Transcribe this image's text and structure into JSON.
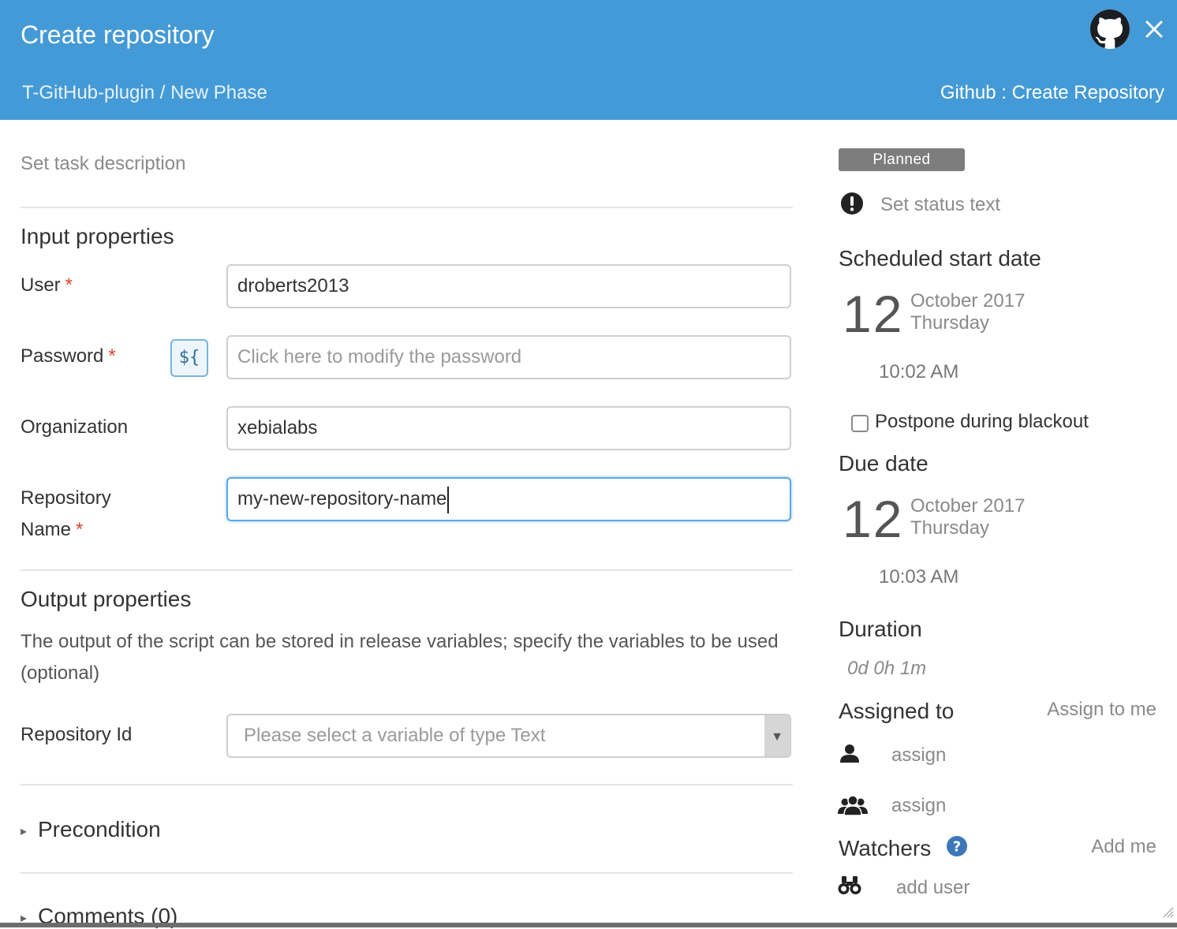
{
  "header": {
    "title": "Create repository",
    "breadcrumb": "T-GitHub-plugin / New Phase",
    "task_type": "Github : Create Repository",
    "icons": [
      "github-icon",
      "close-icon"
    ],
    "color": "#449ad6"
  },
  "main": {
    "task_description_placeholder": "Set task description",
    "input_properties": {
      "title": "Input properties",
      "required_marker": "*",
      "fields": [
        {
          "label": "User",
          "required": true,
          "value": "droberts2013"
        },
        {
          "label": "Password",
          "required": true,
          "placeholder": "Click here to modify the password",
          "variable_button": "${"
        },
        {
          "label": "Organization",
          "required": false,
          "value": "xebialabs"
        },
        {
          "label_line1": "Repository",
          "label_line2": "Name",
          "required": true,
          "value": "my-new-repository-name"
        }
      ]
    },
    "output_properties": {
      "title": "Output properties",
      "description": "The output of the script can be stored in release variables; specify the variables to be used (optional)",
      "fields": [
        {
          "label": "Repository Id",
          "placeholder": "Please select a variable of type Text",
          "arrow": "▼"
        }
      ]
    },
    "precondition": "Precondition",
    "comments": "Comments (0)"
  },
  "sidebar": {
    "status": "Planned",
    "status_text_placeholder": "Set status text",
    "scheduled_start": {
      "title": "Scheduled start date",
      "day": "12",
      "month_year": "October 2017",
      "weekday": "Thursday",
      "time": "10:02 AM"
    },
    "postpone_label": "Postpone during blackout",
    "postpone_checked": false,
    "due_date": {
      "title": "Due date",
      "day": "12",
      "month_year": "October 2017",
      "weekday": "Thursday",
      "time": "10:03 AM"
    },
    "duration": {
      "title": "Duration",
      "value": "0d 0h 1m"
    },
    "assigned": {
      "title": "Assigned to",
      "assign_me": "Assign to me",
      "user_assign": "assign",
      "team_assign": "assign"
    },
    "watchers": {
      "title": "Watchers",
      "add_me": "Add me",
      "add_user": "add user"
    }
  },
  "colors": {
    "header": "#449ad6",
    "required": "#e0412b",
    "status_badge": "#7d7d7d",
    "help": "#3b78b8"
  }
}
